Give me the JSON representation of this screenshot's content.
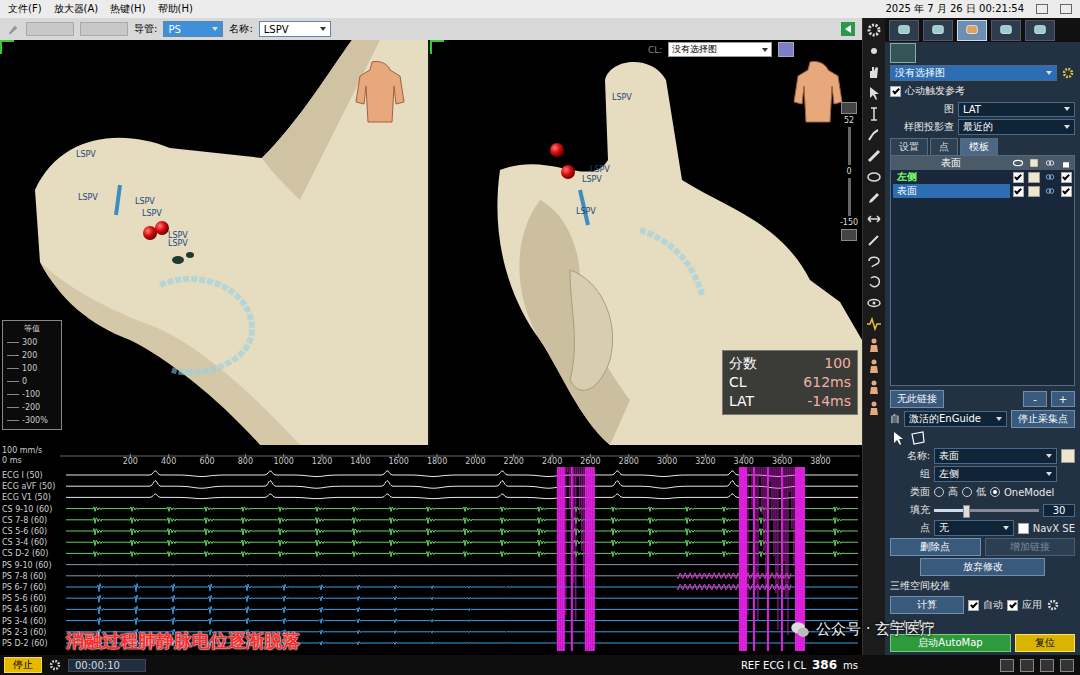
{
  "menu": [
    "文件(F)",
    "放大器(A)",
    "热键(H)",
    "帮助(H)"
  ],
  "datetime": "2025 年 7 月 26 日 00:21:54",
  "toolbar": {
    "catheter_label": "导管:",
    "catheter": "PS",
    "name_label": "名称:",
    "name": "LSPV"
  },
  "left_view": {
    "labels": [
      "LSPV",
      "LSPV",
      "LSPV",
      "LSPV",
      "LSPV",
      "LSPV"
    ],
    "legend": {
      "title": "等值",
      "ticks": [
        "300",
        "200",
        "100",
        "0",
        "-100",
        "-200",
        "-300%"
      ]
    }
  },
  "right_view": {
    "map_label": "CL:",
    "map_select": "没有选择图",
    "labels": [
      "LSPV",
      "LSPV",
      "LSPV",
      "LSPV"
    ],
    "scale": [
      "52",
      "0",
      "-150"
    ],
    "info": [
      {
        "label": "分数",
        "value": "100"
      },
      {
        "label": "CL",
        "value": "612ms"
      },
      {
        "label": "LAT",
        "value": "-14ms"
      }
    ]
  },
  "signals": {
    "speed": "100 mm/s",
    "origin": "0 ms",
    "ticks": [
      "200",
      "400",
      "600",
      "800",
      "1000",
      "1200",
      "1400",
      "1600",
      "1800",
      "2000",
      "2200",
      "2400",
      "2600",
      "2800",
      "3000",
      "3200",
      "3400",
      "3600",
      "3800"
    ],
    "groups": [
      {
        "kind": "ecg",
        "beats": [
          330,
          930,
          1540,
          2140,
          2740,
          3340
        ],
        "channels": [
          {
            "name": "ECG I (50)",
            "color": "#e6e6e6",
            "amp": 0.6,
            "noise": false
          },
          {
            "name": "ECG aVF (50)",
            "color": "#e6e6e6",
            "amp": 0.8,
            "noise": false
          },
          {
            "name": "ECG V1 (50)",
            "color": "#e6e6e6",
            "amp": 0.5,
            "noise": false
          }
        ]
      },
      {
        "kind": "bipolar",
        "beats": [
          20,
          213,
          406,
          599,
          792,
          985,
          1178,
          1371,
          1564,
          1757,
          1950,
          2143,
          2336,
          2529,
          2722,
          2915,
          3108,
          3301,
          3494,
          3687,
          3880
        ],
        "channels": [
          {
            "name": "CS 9-10 (60)",
            "color": "#5fd35f",
            "amp": 0.7,
            "noise": false
          },
          {
            "name": "CS 7-8 (60)",
            "color": "#5fd35f",
            "amp": 0.9,
            "noise": false
          },
          {
            "name": "CS 5-6 (60)",
            "color": "#5fd35f",
            "amp": 1.0,
            "noise": false
          },
          {
            "name": "CS 3-4 (60)",
            "color": "#5fd35f",
            "amp": 0.9,
            "noise": false
          },
          {
            "name": "CS D-2 (60)",
            "color": "#5fd35f",
            "amp": 0.8,
            "noise": false
          }
        ]
      },
      {
        "kind": "bipolar",
        "beats": [
          40,
          233,
          426,
          619,
          812,
          1005,
          1198,
          1391,
          1584,
          1777,
          1970,
          2163
        ],
        "amps": [
          1,
          1,
          0.95,
          0.9,
          0.85,
          0.75,
          0.65,
          0.55,
          0.45,
          0.35,
          0.25,
          0.15
        ],
        "channels": [
          {
            "name": "PS 9-10 (60)",
            "color": "#8899aa",
            "amp": 0.2,
            "noise": false
          },
          {
            "name": "PS 7-8 (60)",
            "color": "#8899aa",
            "amp": 0.25,
            "noise": true
          },
          {
            "name": "PS 6-7 (60)",
            "color": "#3c9ee8",
            "amp": 1.0,
            "noise": true
          },
          {
            "name": "PS 5-6 (60)",
            "color": "#3c9ee8",
            "amp": 0.9,
            "noise": false
          },
          {
            "name": "PS 4-5 (60)",
            "color": "#3c9ee8",
            "amp": 1.0,
            "noise": false
          },
          {
            "name": "PS 3-4 (60)",
            "color": "#3c9ee8",
            "amp": 0.9,
            "noise": false
          },
          {
            "name": "PS 2-3 (60)",
            "color": "#3c9ee8",
            "amp": 0.8,
            "noise": false
          },
          {
            "name": "PS D-2 (60)",
            "color": "#3c9ee8",
            "amp": 0.7,
            "noise": false
          }
        ]
      }
    ],
    "artifacts": [
      {
        "start": 2430,
        "end": 2620
      },
      {
        "start": 3380,
        "end": 3720
      }
    ],
    "noise_window": [
      3050,
      3650
    ],
    "caption": "消融过程肺静脉电位逐渐脱落"
  },
  "mode_tabs": [
    {
      "selected": false
    },
    {
      "selected": false
    },
    {
      "selected": true
    },
    {
      "selected": false
    },
    {
      "selected": false
    }
  ],
  "panel": {
    "map_select": "没有选择图",
    "reference": {
      "label": "心动触发参考",
      "checked": true
    },
    "map": {
      "label": "图",
      "value": "LAT"
    },
    "projection": {
      "label": "样图投影查",
      "value": "最近的"
    },
    "tabs": [
      {
        "label": "设置",
        "selected": false
      },
      {
        "label": "点",
        "selected": false
      },
      {
        "label": "模板",
        "selected": true
      }
    ],
    "surface_table": {
      "header": "表面",
      "rows": [
        {
          "label": "左侧",
          "selected": false,
          "visible": true
        },
        {
          "label": "表面",
          "selected": true,
          "visible": true
        }
      ]
    },
    "link": {
      "label": "无此链接",
      "remove": "-",
      "add": "+"
    },
    "enguide": {
      "label": "自",
      "value": "激活的EnGuide",
      "button": "停止采集点"
    },
    "fields": [
      {
        "label": "名称:",
        "value": "表面"
      },
      {
        "label": "组",
        "value": "左侧"
      }
    ],
    "type": {
      "label": "类面",
      "options": [
        {
          "label": "高",
          "selected": false
        },
        {
          "label": "低",
          "selected": false
        },
        {
          "label": "OneModel",
          "selected": true
        }
      ]
    },
    "fill": {
      "label": "填充",
      "level": 0.3,
      "value": "30"
    },
    "points": {
      "label": "点",
      "value": "无",
      "navx": {
        "label": "NavX SE",
        "checked": false
      }
    },
    "buttons": [
      {
        "label": "删除点",
        "disabled": false
      },
      {
        "label": "增加链接",
        "disabled": true
      }
    ],
    "discard": "放弃修改",
    "calib": {
      "title": "三维空间校准",
      "button": "计算",
      "auto": {
        "label": "自动",
        "checked": true
      },
      "apply": {
        "label": "应用",
        "checked": true
      }
    },
    "automap": {
      "label": "AutoMap",
      "start": "启动AutoMap",
      "reset": "复位"
    }
  },
  "status": {
    "stop": "停止",
    "timer": "00:00:10",
    "ref_label": "REF ECG I CL",
    "ref_value": "386",
    "ref_unit": "ms"
  },
  "watermark": "公众号 · 玄宇医疗"
}
